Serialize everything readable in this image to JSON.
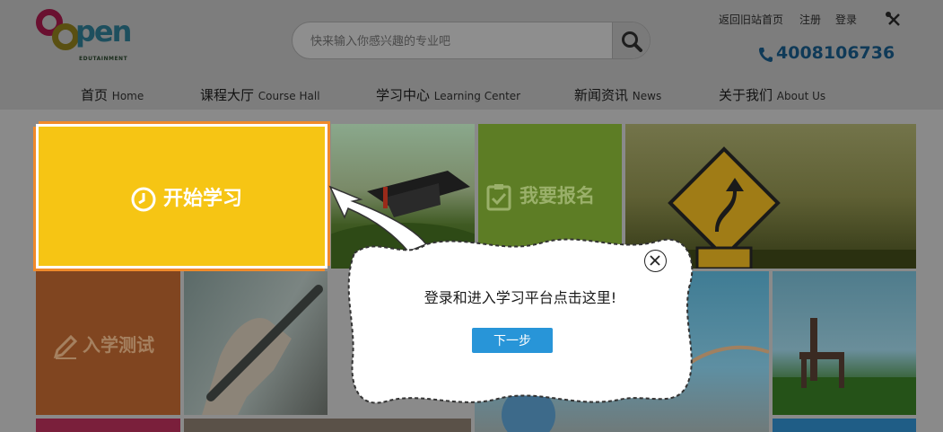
{
  "header": {
    "logo_text": "pen",
    "logo_sub": "EDUTAINMENT",
    "search_placeholder": "快来输入你感兴趣的专业吧",
    "top_links": [
      "返回旧站首页",
      "注册",
      "登录"
    ],
    "phone": "4008106736"
  },
  "nav": [
    {
      "cn": "首页",
      "en": "Home"
    },
    {
      "cn": "课程大厅",
      "en": "Course Hall"
    },
    {
      "cn": "学习中心",
      "en": "Learning Center"
    },
    {
      "cn": "新闻资讯",
      "en": "News"
    },
    {
      "cn": "关于我们",
      "en": "About Us"
    }
  ],
  "tiles": {
    "start_label": "开始学习",
    "signup_label": "我要报名",
    "test_label": "入学测试"
  },
  "tour": {
    "message": "登录和进入学习平台点击这里!",
    "next_label": "下一步"
  },
  "colors": {
    "accent_blue": "#2895d8",
    "start_yellow": "#f6c514",
    "signup_green": "#5d7d25",
    "test_orange": "#804520"
  }
}
